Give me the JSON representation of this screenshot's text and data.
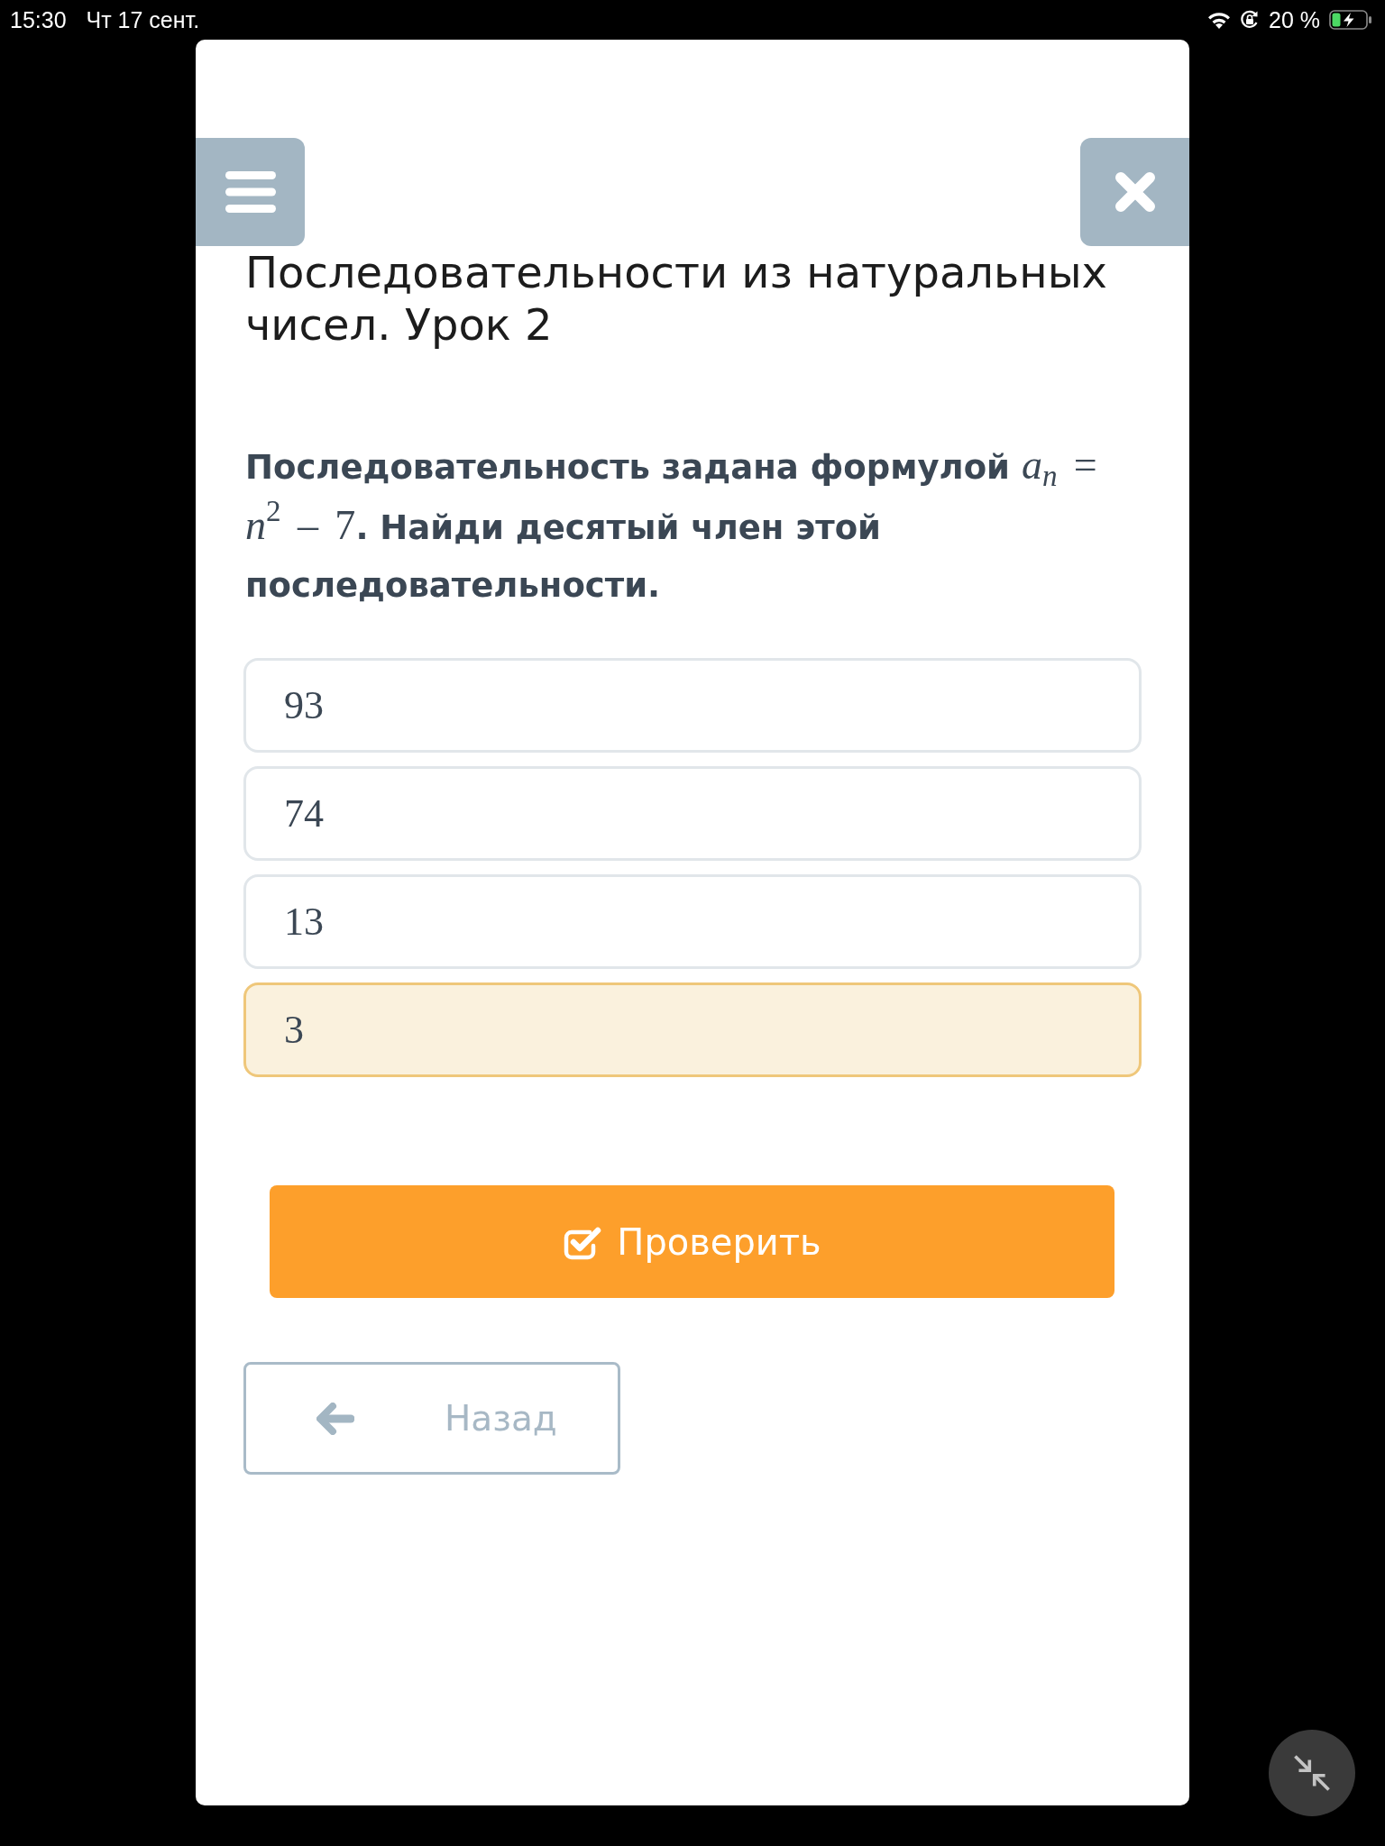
{
  "status_bar": {
    "time": "15:30",
    "date": "Чт 17 сент.",
    "battery": "20 %"
  },
  "title": "Последовательности из натуральных чисел. Урок 2",
  "question": [
    {
      "kind": "text",
      "text": "Последовательность задана формулой "
    },
    {
      "kind": "math",
      "text": "*a*$_{n}$ = *n*$^{2}$ – 7"
    },
    {
      "kind": "text",
      "text": ". Найди десятый член этой последовательности."
    }
  ],
  "options": [
    {
      "label": "93",
      "selected": false
    },
    {
      "label": "74",
      "selected": false
    },
    {
      "label": "13",
      "selected": false
    },
    {
      "label": "3",
      "selected": true
    }
  ],
  "check_button": {
    "label": "Проверить"
  },
  "back_button": {
    "label": "Назад"
  }
}
